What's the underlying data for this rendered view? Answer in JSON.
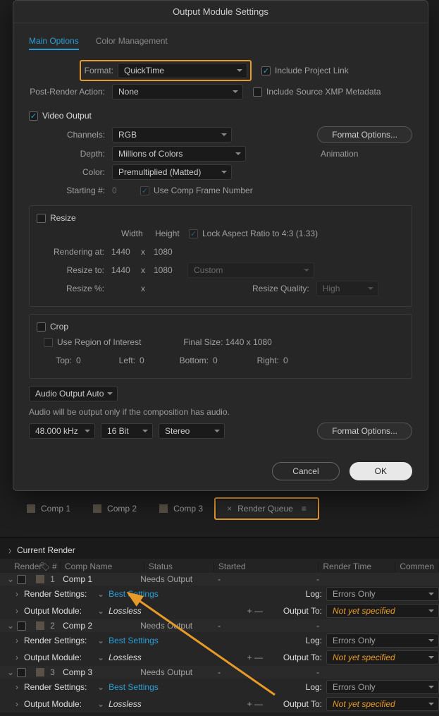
{
  "dialog": {
    "title": "Output Module Settings",
    "tabs": {
      "main": "Main Options",
      "color": "Color Management"
    },
    "format": {
      "label": "Format:",
      "value": "QuickTime"
    },
    "postRender": {
      "label": "Post-Render Action:",
      "value": "None"
    },
    "includeProjectLink": "Include Project Link",
    "includeXMP": "Include Source XMP Metadata",
    "videoOutput": "Video Output",
    "channels": {
      "label": "Channels:",
      "value": "RGB"
    },
    "depth": {
      "label": "Depth:",
      "value": "Millions of Colors"
    },
    "color": {
      "label": "Color:",
      "value": "Premultiplied (Matted)"
    },
    "startingFrame": {
      "label": "Starting #:",
      "value": "0"
    },
    "useCompFrame": "Use Comp Frame Number",
    "formatOptions": "Format Options...",
    "codec": "Animation",
    "resize": {
      "title": "Resize",
      "width": "Width",
      "height": "Height",
      "lockAspect": "Lock Aspect Ratio to 4:3 (1.33)",
      "renderingAt": "Rendering at:",
      "raW": "1440",
      "raH": "1080",
      "x": "x",
      "resizeTo": "Resize to:",
      "rtW": "1440",
      "rtH": "1080",
      "custom": "Custom",
      "resizePct": "Resize %:",
      "resizeQuality": "Resize Quality:",
      "high": "High"
    },
    "crop": {
      "title": "Crop",
      "useROI": "Use Region of Interest",
      "finalSize": "Final Size: 1440 x 1080",
      "top": "Top:",
      "left": "Left:",
      "bottom": "Bottom:",
      "right": "Right:",
      "zero": "0"
    },
    "audio": {
      "output": "Audio Output Auto",
      "note": "Audio will be output only if the composition has audio.",
      "rate": "48.000 kHz",
      "bits": "16 Bit",
      "channels": "Stereo",
      "formatOptions": "Format Options..."
    },
    "cancel": "Cancel",
    "ok": "OK"
  },
  "panelTabs": {
    "comps": [
      "Comp 1",
      "Comp 2",
      "Comp 3"
    ],
    "renderQueue": "Render Queue"
  },
  "currentRender": "Current Render",
  "tableHeaders": {
    "render": "Render",
    "num": "#",
    "compName": "Comp Name",
    "status": "Status",
    "started": "Started",
    "renderTime": "Render Time",
    "comment": "Commen"
  },
  "queue": {
    "renderSettings": "Render Settings:",
    "outputModule": "Output Module:",
    "bestSettings": "Best Settings",
    "lossless": "Lossless",
    "log": "Log:",
    "errorsOnly": "Errors Only",
    "outputTo": "Output To:",
    "notYetSpecified": "Not yet specified",
    "needsOutput": "Needs Output",
    "dash": "-",
    "items": [
      {
        "num": "1",
        "name": "Comp 1"
      },
      {
        "num": "2",
        "name": "Comp 2"
      },
      {
        "num": "3",
        "name": "Comp 3"
      }
    ]
  }
}
